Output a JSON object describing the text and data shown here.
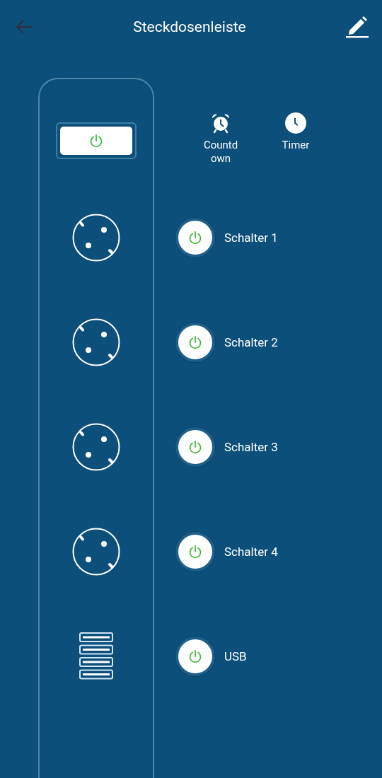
{
  "header": {
    "title": "Steckdosenleiste"
  },
  "master": {
    "on": true
  },
  "shortcuts": [
    {
      "kind": "alarm",
      "label": "Countdown"
    },
    {
      "kind": "clock",
      "label": "Timer"
    }
  ],
  "switches": [
    {
      "kind": "socket",
      "label": "Schalter 1",
      "on": true
    },
    {
      "kind": "socket",
      "label": "Schalter 2",
      "on": true
    },
    {
      "kind": "socket",
      "label": "Schalter 3",
      "on": true
    },
    {
      "kind": "socket",
      "label": "Schalter 4",
      "on": true
    },
    {
      "kind": "usb",
      "label": "USB",
      "on": true
    }
  ]
}
